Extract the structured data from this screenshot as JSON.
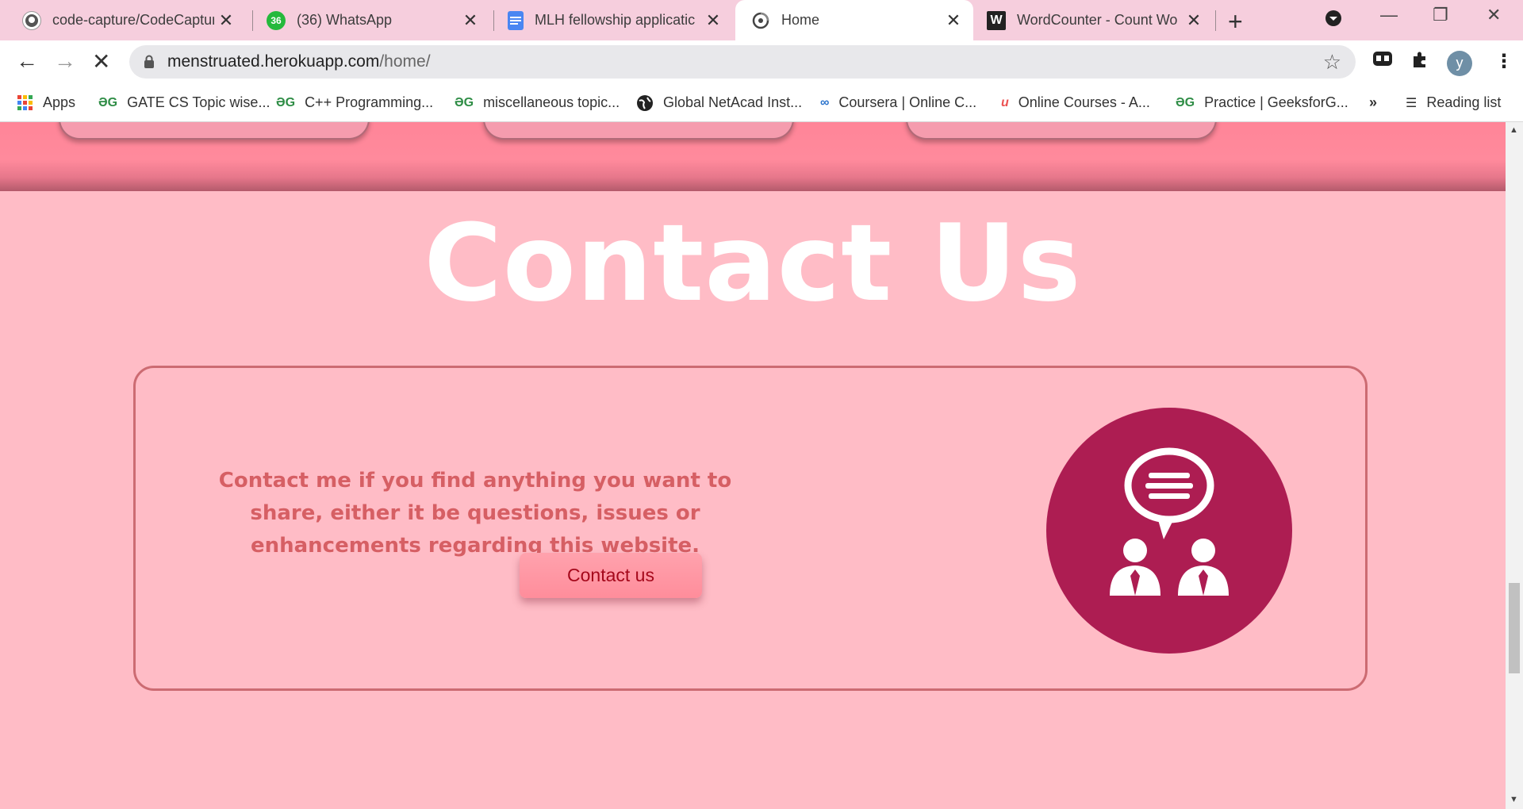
{
  "tabs": [
    {
      "title": "code-capture/CodeCaptur",
      "icon": "github-icon"
    },
    {
      "title": "(36) WhatsApp",
      "icon": "whatsapp-icon",
      "badge": "36"
    },
    {
      "title": "MLH fellowship applicatic",
      "icon": "google-docs-icon"
    },
    {
      "title": "Home",
      "icon": "loading-icon"
    },
    {
      "title": "WordCounter - Count Wo",
      "icon": "wordcounter-icon",
      "letter": "W"
    }
  ],
  "address_bar": {
    "host": "menstruated.herokuapp.com",
    "path": "/home/"
  },
  "profile": {
    "initial": "y"
  },
  "bookmarks": {
    "apps": "Apps",
    "items": [
      {
        "label": "GATE CS Topic wise...",
        "icon": "geeksforgeeks-icon"
      },
      {
        "label": "C++ Programming...",
        "icon": "geeksforgeeks-icon"
      },
      {
        "label": "miscellaneous topic...",
        "icon": "geeksforgeeks-icon"
      },
      {
        "label": "Global NetAcad Inst...",
        "icon": "globe-icon"
      },
      {
        "label": "Coursera | Online C...",
        "icon": "coursera-icon"
      },
      {
        "label": "Online Courses - A...",
        "icon": "udemy-icon"
      },
      {
        "label": "Practice | GeeksforG...",
        "icon": "geeksforgeeks-icon"
      }
    ],
    "overflow": "»",
    "reading_list": "Reading list"
  },
  "page": {
    "contact_title": "Contact Us",
    "contact_text": "Contact me if you find anything you want to share, either it be questions, issues or enhancements regarding this website.",
    "contact_button": "Contact us",
    "colors": {
      "background": "#ffbcc6",
      "band": "#ff8598",
      "text": "#d65f64",
      "icon_circle": "#ad1d52",
      "button_text": "#a5081b"
    }
  }
}
